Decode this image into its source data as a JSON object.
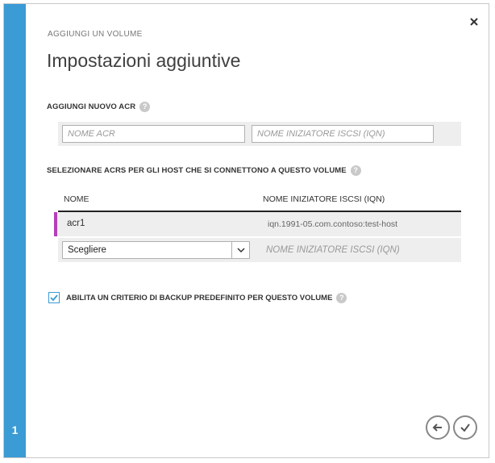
{
  "wizard": {
    "breadcrumb": "AGGIUNGI UN VOLUME",
    "title": "Impostazioni aggiuntive",
    "step_number": "1"
  },
  "add_acr": {
    "label": "AGGIUNGI NUOVO ACR",
    "name_placeholder": "NOME ACR",
    "iqn_placeholder": "NOME INIZIATORE ISCSI (IQN)"
  },
  "select_acrs": {
    "label": "SELEZIONARE ACRS PER GLI HOST CHE SI CONNETTONO A QUESTO VOLUME",
    "columns": [
      "NOME",
      "NOME INIZIATORE ISCSI (IQN)"
    ],
    "rows": [
      {
        "name": "acr1",
        "iqn": "iqn.1991-05.com.contoso:test-host"
      }
    ],
    "new_row": {
      "select_value": "Scegliere",
      "iqn_placeholder": "NOME INIZIATORE ISCSI (IQN)"
    }
  },
  "backup_policy": {
    "label": "ABILITA UN CRITERIO DI BACKUP PREDEFINITO PER QUESTO VOLUME",
    "checked": true
  },
  "colors": {
    "step_rail": "#3a9bd5",
    "row_accent": "#b43fb9"
  },
  "icons": [
    "close-icon",
    "help-icon",
    "chevron-down-icon",
    "checkmark-icon",
    "back-arrow-icon"
  ]
}
